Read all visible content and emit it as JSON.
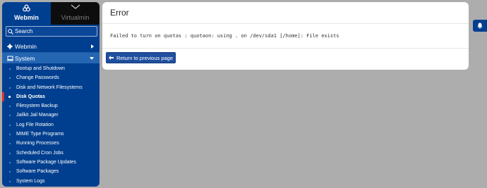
{
  "sidebar": {
    "tabs": [
      {
        "label": "Webmin",
        "icon": "webmin-logo-icon"
      },
      {
        "label": "Virtualmin",
        "icon": "chevron-down-icon"
      }
    ],
    "search_placeholder": "Search",
    "sections": [
      {
        "label": "Webmin",
        "icon": "gear-icon"
      },
      {
        "label": "System",
        "icon": "computer-icon"
      }
    ],
    "items": [
      {
        "label": "Bootup and Shutdown"
      },
      {
        "label": "Change Passwords"
      },
      {
        "label": "Disk and Network Filesystems"
      },
      {
        "label": "Disk Quotas"
      },
      {
        "label": "Filesystem Backup"
      },
      {
        "label": "Jailkit Jail Manager"
      },
      {
        "label": "Log File Rotation"
      },
      {
        "label": "MIME Type Programs"
      },
      {
        "label": "Running Processes"
      },
      {
        "label": "Scheduled Cron Jobs"
      },
      {
        "label": "Software Package Updates"
      },
      {
        "label": "Software Packages"
      },
      {
        "label": "System Logs"
      }
    ],
    "active_item": "Disk Quotas"
  },
  "main": {
    "title": "Error",
    "message": "Failed to turn on quotas : quotaon: using . on /dev/sda1 [/home]: File exists",
    "return_button": "Return to previous page"
  },
  "colors": {
    "sidebar_bg": "#003f8f",
    "active_marker": "#d9322f",
    "button_bg": "#1f4f9f"
  }
}
